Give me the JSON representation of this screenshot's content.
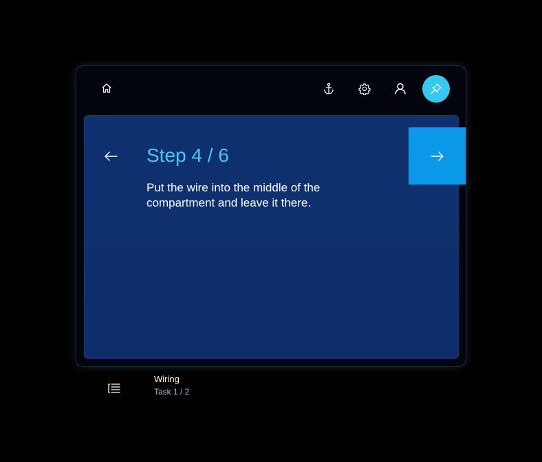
{
  "toolbar": {
    "home_icon": "home-icon",
    "anchor_icon": "anchor-icon",
    "settings_icon": "gear-icon",
    "user_icon": "user-icon",
    "pin_icon": "pin-icon",
    "pin_color": "#35c8f0"
  },
  "step": {
    "title": "Step 4 / 6",
    "text": " Put the wire into the middle of the\ncompartment and leave it there.",
    "title_color": "#4fc3f7",
    "next_color": "#0a98e8",
    "card_color": "#0f3170"
  },
  "task": {
    "name": "Wiring",
    "progress": "Task 1 / 2"
  }
}
